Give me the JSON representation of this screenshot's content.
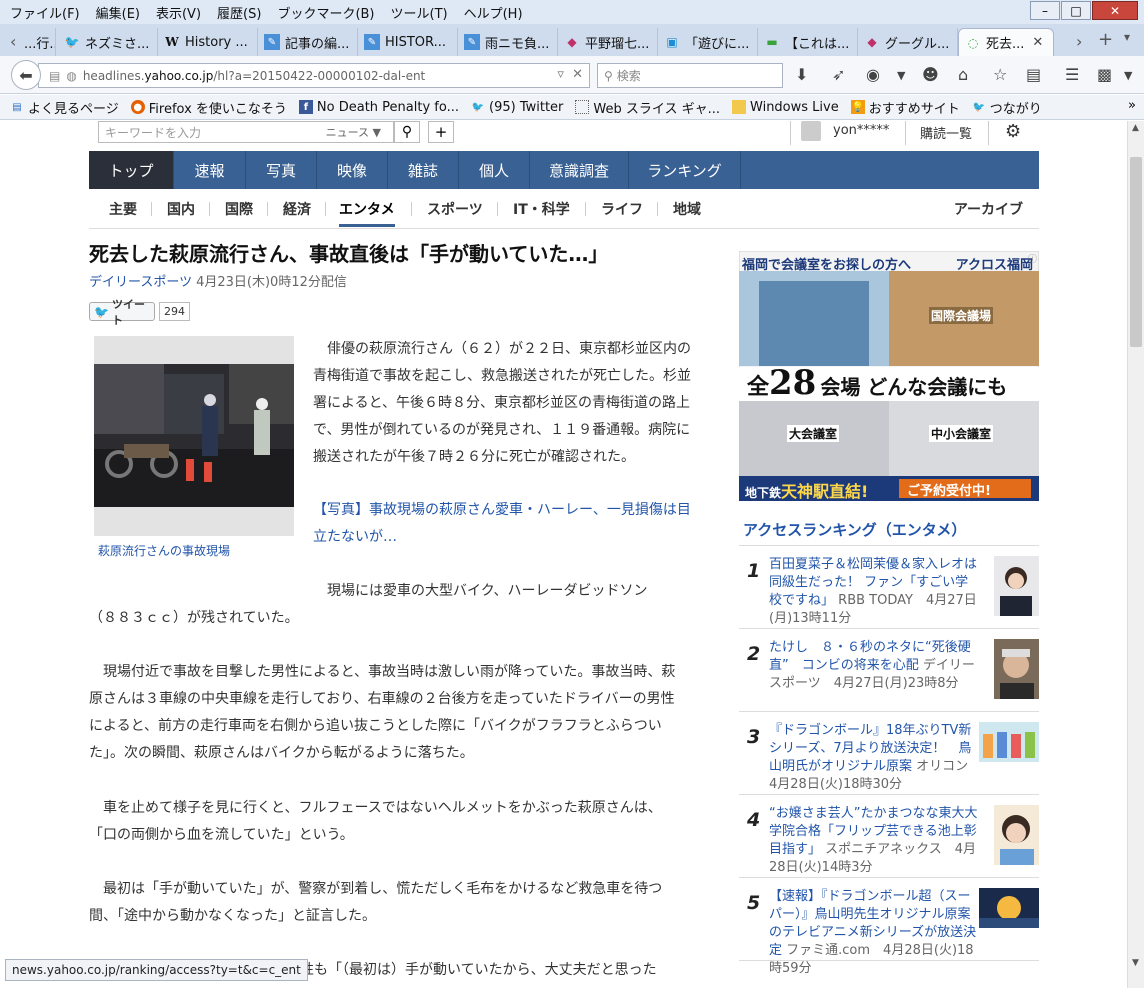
{
  "menubar": {
    "items": [
      "ファイル(F)",
      "編集(E)",
      "表示(V)",
      "履歴(S)",
      "ブックマーク(B)",
      "ツール(T)",
      "ヘルプ(H)"
    ]
  },
  "window_controls": {
    "minimize": "–",
    "maximize": "□",
    "close": "✕"
  },
  "tabs": [
    {
      "label": "...行...",
      "icon": "page-icon"
    },
    {
      "label": "ネズミさ...",
      "icon": "twitter-icon"
    },
    {
      "label": "History ...",
      "icon": "wikipedia-icon"
    },
    {
      "label": "記事の編...",
      "icon": "edit-icon"
    },
    {
      "label": "HISTOR...",
      "icon": "edit-icon"
    },
    {
      "label": "雨ニモ負...",
      "icon": "edit-icon"
    },
    {
      "label": "平野瑠七...",
      "icon": "gem-icon"
    },
    {
      "label": "「遊びに...",
      "icon": "video-icon"
    },
    {
      "label": "【これは...",
      "icon": "battery-icon"
    },
    {
      "label": "グーグル...",
      "icon": "gem-icon"
    },
    {
      "label": "死去...",
      "icon": "loading-icon",
      "active": true
    }
  ],
  "urlbar": {
    "prefix": "headlines.",
    "host": "yahoo.co.jp",
    "path": "/hl?a=20150422-00000102-dal-ent"
  },
  "search": {
    "placeholder": "検索"
  },
  "bookmarks": [
    {
      "label": "よく見るページ",
      "icon": "bookmark-icon"
    },
    {
      "label": "Firefox を使いこなそう",
      "icon": "firefox-icon"
    },
    {
      "label": "No Death Penalty fo...",
      "icon": "facebook-icon"
    },
    {
      "label": "(95) Twitter",
      "icon": "twitter-icon"
    },
    {
      "label": "Web スライス ギャ...",
      "icon": "webslice-icon"
    },
    {
      "label": "Windows Live",
      "icon": "folder-icon"
    },
    {
      "label": "おすすめサイト",
      "icon": "bulb-icon"
    },
    {
      "label": "つながり",
      "icon": "twitter-icon"
    }
  ],
  "yahoo": {
    "search_placeholder": "キーワードを入力",
    "search_category": "ニュース ▼",
    "user": "yon*****",
    "readlist": "購読一覧"
  },
  "global_nav": [
    "トップ",
    "速報",
    "写真",
    "映像",
    "雑誌",
    "個人",
    "意識調査",
    "ランキング"
  ],
  "sub_nav": [
    "主要",
    "国内",
    "国際",
    "経済",
    "エンタメ",
    "スポーツ",
    "IT・科学",
    "ライフ",
    "地域"
  ],
  "archive": "アーカイブ",
  "article": {
    "headline": "死去した萩原流行さん、事故直後は「手が動いていた…」",
    "source": "デイリースポーツ",
    "date": "4月23日(木)0時12分配信",
    "tweet_label": "ツイート",
    "tweet_count": "294",
    "photo_caption": "萩原流行さんの事故現場",
    "p1": [
      "　俳優の萩原流行さん（６２）が２２日、東京都杉並区内の",
      "青梅街道で事故を起こし、救急搬送されたが死亡した。杉並",
      "署によると、午後６時８分、東京都杉並区の青梅街道の路上",
      "で、男性が倒れているのが発見され、１１９番通報。病院に",
      "搬送されたが午後７時２６分に死亡が確認された。"
    ],
    "photo_link": [
      "【写真】事故現場の萩原さん愛車・ハーレー、一見損傷は目",
      "立たないが…"
    ],
    "p2a": "　現場には愛車の大型バイク、ハーレーダビッドソン",
    "p2b": "（８８３ｃｃ）が残されていた。",
    "p3": [
      "　現場付近で事故を目撃した男性によると、事故当時は激しい雨が降っていた。事故当時、萩",
      "原さんは３車線の中央車線を走行しており、右車線の２台後方を走っていたドライバーの男性",
      "によると、前方の走行車両を右側から追い抜こうとした際に「バイクがフラフラとふらつい",
      "た」。次の瞬間、萩原さんはバイクから転がるように落ちた。"
    ],
    "p4": [
      "　車を止めて様子を見に行くと、フルフェースではないヘルメットをかぶった萩原さんは、",
      "「口の両側から血を流していた」という。"
    ],
    "p5": [
      "　最初は「手が動いていた」が、警察が到着し、慌ただしく毛布をかけるなど救急車を待つ",
      "間、「途中から動かなくなった」と証言した。"
    ],
    "p6": "性も「（最初は）手が動いていたから、大丈夫だと思った"
  },
  "ad": {
    "line1": "福岡で会議室をお探しの方へ",
    "brand": "アクロス福岡",
    "label_intl": "国際会議場",
    "big_prefix": "全",
    "big_number": "28",
    "big_suffix": "会場 どんな会議にも",
    "label_large": "大会議室",
    "label_small": "中小会議室",
    "station_prefix": "地下鉄",
    "station": "天神",
    "station_suffix": "駅直結!",
    "cta": "ご予約受付中!"
  },
  "ranking": {
    "heading": "アクセスランキング（エンタメ）",
    "items": [
      {
        "num": "1",
        "title": "百田夏菜子＆松岡茉優＆家入レオは同級生だった！ ファン「すごい学校ですね」",
        "meta": "RBB TODAY　4月27日(月)13時11分"
      },
      {
        "num": "2",
        "title": "たけし　８・６秒のネタに“死後硬直”　コンビの将来を心配",
        "meta": "デイリースポーツ　4月27日(月)23時8分"
      },
      {
        "num": "3",
        "title": "『ドラゴンボール』18年ぶりTV新シリーズ、7月より放送決定！　鳥山明氏がオリジナル原案",
        "meta": "オリコン　4月28日(火)18時30分"
      },
      {
        "num": "4",
        "title": "“お嬢さま芸人”たかまつなな東大大学院合格「フリップ芸できる池上彰目指す」",
        "meta": "スポニチアネックス　4月28日(火)14時3分"
      },
      {
        "num": "5",
        "title": "【速報】『ドラゴンボール超（スーパー）』鳥山明先生オリジナル原案のテレビアニメ新シリーズが放送決定",
        "meta": "ファミ通.com　4月28日(火)18時59分"
      }
    ]
  },
  "statusbar": "news.yahoo.co.jp/ranking/access?ty=t&c=c_ent",
  "colors": {
    "nav_blue": "#3a6194",
    "link_blue": "#2255aa",
    "nav_active": "#2a2f3a"
  }
}
